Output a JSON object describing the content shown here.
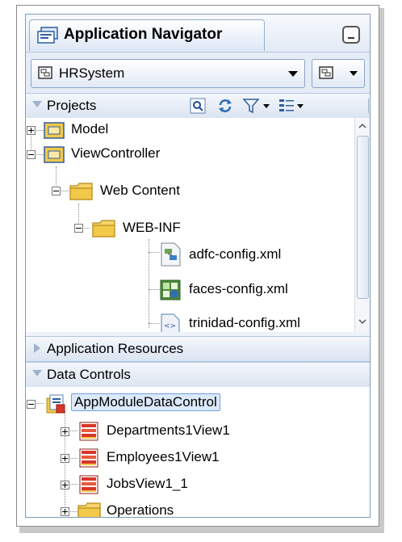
{
  "navigator": {
    "title": "Application Navigator",
    "application": "HRSystem"
  },
  "projects": {
    "header": "Projects",
    "tree": [
      {
        "label": "Model",
        "expander": "plus",
        "icon": "folder-icon"
      },
      {
        "label": "ViewController",
        "expander": "minus",
        "icon": "folder-icon"
      },
      {
        "label": "Web Content",
        "expander": "minus",
        "icon": "folder-icon"
      },
      {
        "label": "WEB-INF",
        "expander": "minus",
        "icon": "folder-icon"
      },
      {
        "label": "adfc-config.xml",
        "icon": "adfc-config-file-icon"
      },
      {
        "label": "faces-config.xml",
        "icon": "faces-config-file-icon"
      },
      {
        "label": "trinidad-config.xml",
        "icon": "xml-file-icon"
      }
    ]
  },
  "application_resources": {
    "header": "Application Resources"
  },
  "data_controls": {
    "header": "Data Controls",
    "root": {
      "label": "AppModuleDataControl",
      "selected": true
    },
    "children": [
      {
        "label": "Departments1View1",
        "icon": "view-object-icon"
      },
      {
        "label": "Employees1View1",
        "icon": "view-object-icon"
      },
      {
        "label": "JobsView1_1",
        "icon": "view-object-icon"
      },
      {
        "label": "Operations",
        "icon": "folder-icon"
      }
    ]
  },
  "colors": {
    "panel_bg": "#eef3fb",
    "border": "#7f9db9",
    "folder": "#f3c94a",
    "view_object": "#d9352a",
    "selection": "#dce9fb"
  }
}
